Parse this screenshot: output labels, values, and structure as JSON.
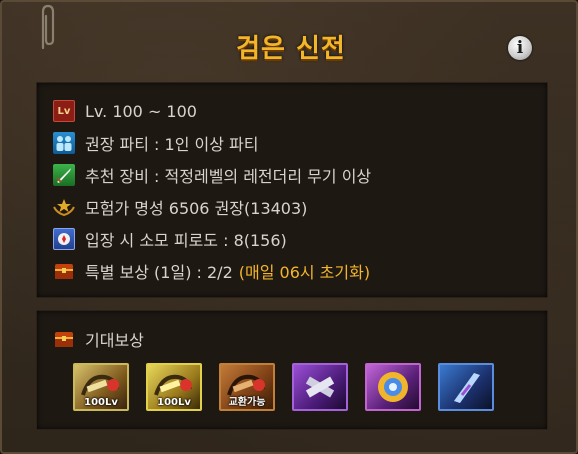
{
  "dialog": {
    "title": "검은 신전",
    "info_icon": "i"
  },
  "details": [
    {
      "icon": "level-icon",
      "icon_text": "Lv",
      "text": "Lv. 100 ~ 100",
      "highlight": ""
    },
    {
      "icon": "party-icon",
      "icon_text": "",
      "text": "권장 파티 : 1인 이상 파티",
      "highlight": ""
    },
    {
      "icon": "equipment-icon",
      "icon_text": "",
      "text": "추천 장비 : 적정레벨의 레전더리 무기 이상",
      "highlight": ""
    },
    {
      "icon": "adventurer-fame-icon",
      "icon_text": "",
      "text": "모험가 명성 6506 권장(13403)",
      "highlight": ""
    },
    {
      "icon": "fatigue-icon",
      "icon_text": "",
      "text": "입장 시 소모 피로도 : 8(156)",
      "highlight": ""
    },
    {
      "icon": "reward-chest-icon",
      "icon_text": "",
      "text": "특별 보상 (1일) : 2/2",
      "highlight": "(매일 06시 초기화)"
    }
  ],
  "expected_rewards": {
    "label": "기대보상",
    "items": [
      {
        "name": "reward-item-1",
        "tag": "100Lv"
      },
      {
        "name": "reward-item-2",
        "tag": "100Lv"
      },
      {
        "name": "reward-item-3",
        "tag": "교환가능"
      },
      {
        "name": "reward-item-4",
        "tag": ""
      },
      {
        "name": "reward-item-5",
        "tag": ""
      },
      {
        "name": "reward-item-6",
        "tag": ""
      }
    ]
  },
  "colors": {
    "title": "#f3b52a",
    "highlight": "#f3b52a",
    "text": "#d8d3cc",
    "panel": "#342a1f"
  }
}
